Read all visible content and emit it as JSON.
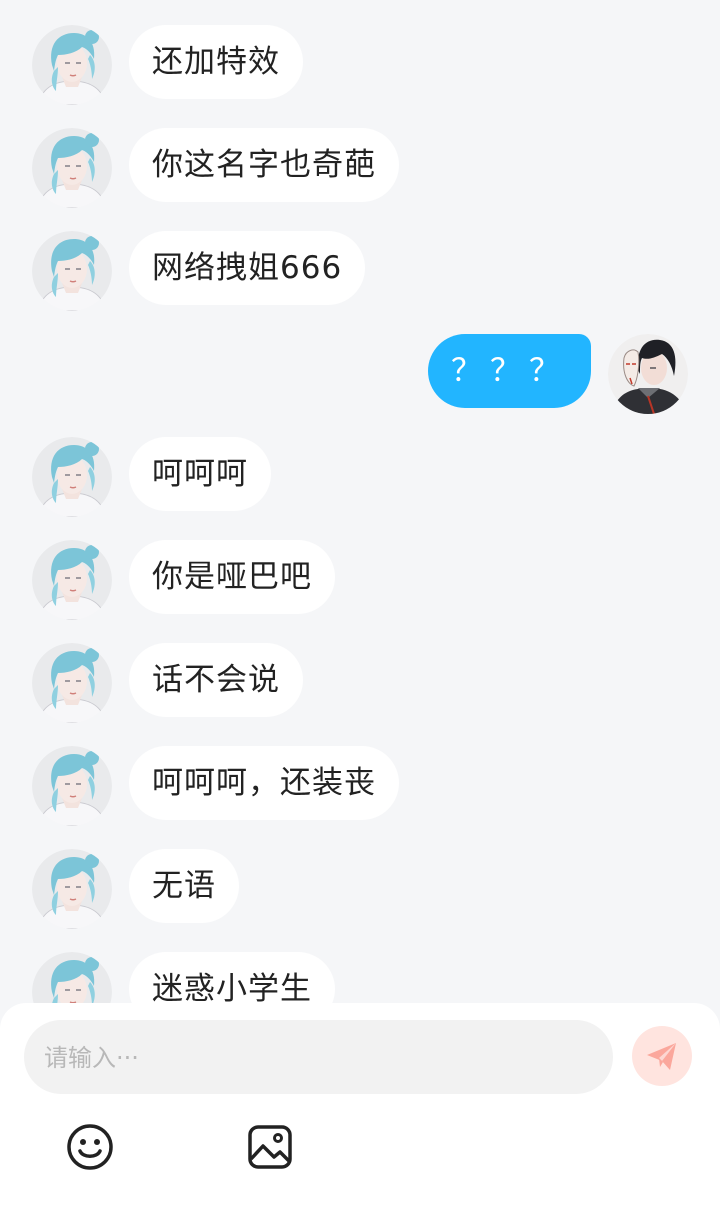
{
  "messages": [
    {
      "side": "in",
      "text": "还加特效"
    },
    {
      "side": "in",
      "text": "你这名字也奇葩"
    },
    {
      "side": "in",
      "text": "网络拽姐666"
    },
    {
      "side": "out",
      "text": "？？？"
    },
    {
      "side": "in",
      "text": "呵呵呵"
    },
    {
      "side": "in",
      "text": "你是哑巴吧"
    },
    {
      "side": "in",
      "text": "话不会说"
    },
    {
      "side": "in",
      "text": "呵呵呵，还装丧"
    },
    {
      "side": "in",
      "text": "无语"
    },
    {
      "side": "in",
      "text": "迷惑小学生"
    }
  ],
  "composer": {
    "placeholder": "请输入···",
    "value": "",
    "send_icon": "paper-plane-icon",
    "tools": [
      "emoji-icon",
      "image-icon"
    ]
  },
  "colors": {
    "background": "#f5f6f8",
    "incoming_bubble": "#ffffff",
    "outgoing_bubble": "#22b5ff",
    "send_button": "#ffe4df",
    "send_icon": "#fba79c"
  }
}
